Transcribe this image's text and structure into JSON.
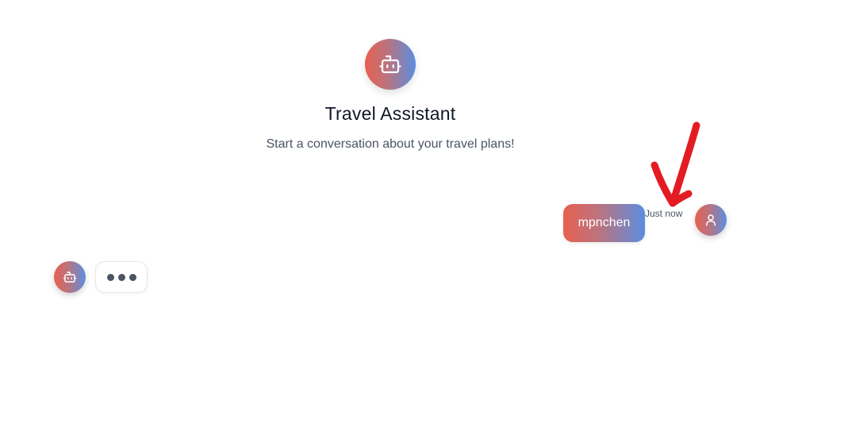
{
  "app": {
    "title": "Travel Assistant",
    "subtitle": "Start a conversation about your travel plans!",
    "avatar_icon": "bot-icon"
  },
  "messages": [
    {
      "role": "user",
      "text": "mpnchen",
      "timestamp": "Just now",
      "avatar_icon": "user-icon"
    }
  ],
  "typing_indicator": {
    "role": "assistant",
    "avatar_icon": "bot-icon",
    "dots": 3
  },
  "annotation": {
    "type": "red-arrow",
    "color": "#e31b23"
  },
  "colors": {
    "gradient_start": "#e8604f",
    "gradient_end": "#5b8ee0",
    "text_primary": "#111827",
    "text_secondary": "#4b5563"
  }
}
